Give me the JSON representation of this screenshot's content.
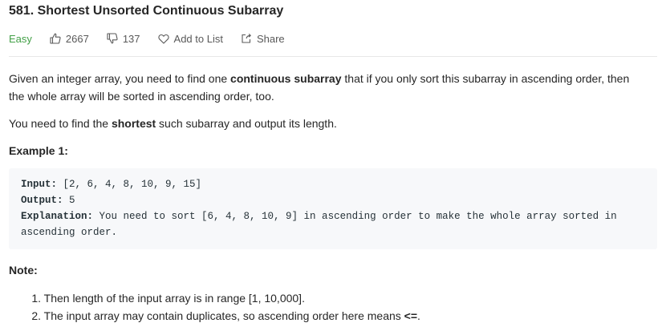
{
  "problem": {
    "title": "581. Shortest Unsorted Continuous Subarray",
    "difficulty": "Easy",
    "likes": "2667",
    "dislikes": "137",
    "add_to_list": "Add to List",
    "share": "Share",
    "difficulty_color": "#43a047"
  },
  "description": {
    "p1_a": "Given an integer array, you need to find one ",
    "p1_bold": "continuous subarray",
    "p1_b": " that if you only sort this subarray in ascending order, then",
    "p1_c": "the whole array will be sorted in ascending order, too.",
    "p2_a": "You need to find the ",
    "p2_bold": "shortest",
    "p2_b": " such subarray and output its length."
  },
  "example": {
    "heading": "Example 1:",
    "input_label": "Input:",
    "input_value": " [2, 6, 4, 8, 10, 9, 15]",
    "output_label": "Output:",
    "output_value": " 5",
    "explanation_label": "Explanation:",
    "explanation_value": " You need to sort [6, 4, 8, 10, 9] in ascending order to make the whole array sorted in",
    "explanation_cont": "ascending order."
  },
  "note": {
    "heading": "Note:",
    "items": [
      {
        "num": "1.",
        "text": "Then length of the input array is in range [1, 10,000]."
      },
      {
        "num": "2.",
        "text_a": "The input array may contain duplicates, so ascending order here means ",
        "text_bold": "<=",
        "text_b": "."
      }
    ]
  }
}
